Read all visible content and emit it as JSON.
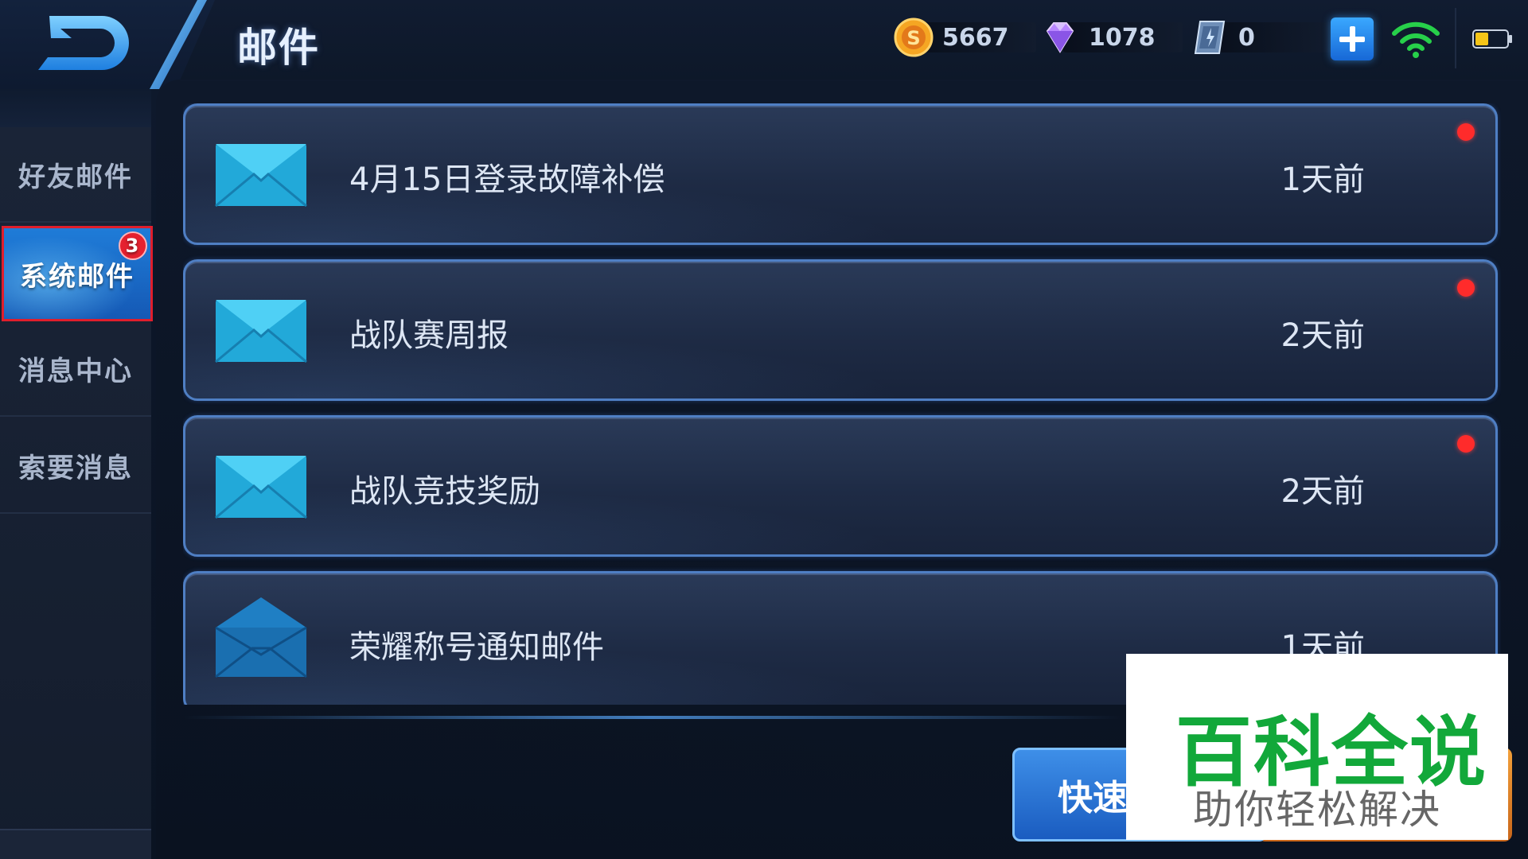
{
  "header": {
    "title": "邮件",
    "currencies": [
      {
        "icon": "gold-coin-icon",
        "value": "5667"
      },
      {
        "icon": "diamond-icon",
        "value": "1078"
      },
      {
        "icon": "voucher-icon",
        "value": "0"
      }
    ]
  },
  "sidebar": {
    "items": [
      {
        "label": "好友邮件",
        "active": false
      },
      {
        "label": "系统邮件",
        "active": true,
        "badge": "3"
      },
      {
        "label": "消息中心",
        "active": false
      },
      {
        "label": "索要消息",
        "active": false
      }
    ]
  },
  "mails": [
    {
      "subject": "4月15日登录故障补偿",
      "time": "1天前",
      "unread": true,
      "icon": "closed-envelope-icon"
    },
    {
      "subject": "战队赛周报",
      "time": "2天前",
      "unread": true,
      "icon": "closed-envelope-icon"
    },
    {
      "subject": "战队竞技奖励",
      "time": "2天前",
      "unread": true,
      "icon": "closed-envelope-icon"
    },
    {
      "subject": "荣耀称号通知邮件",
      "time": "1天前",
      "unread": false,
      "icon": "open-envelope-icon"
    }
  ],
  "footer": {
    "quick_label": "快速"
  },
  "watermark": {
    "main": "百科全说",
    "sub": "助你轻松解决"
  },
  "colors": {
    "accent_blue": "#1f7cd8",
    "card_border": "#4f7fc4",
    "unread_red": "#ff2b2b",
    "active_border": "#e01e2c",
    "watermark_green": "#12a83a"
  }
}
